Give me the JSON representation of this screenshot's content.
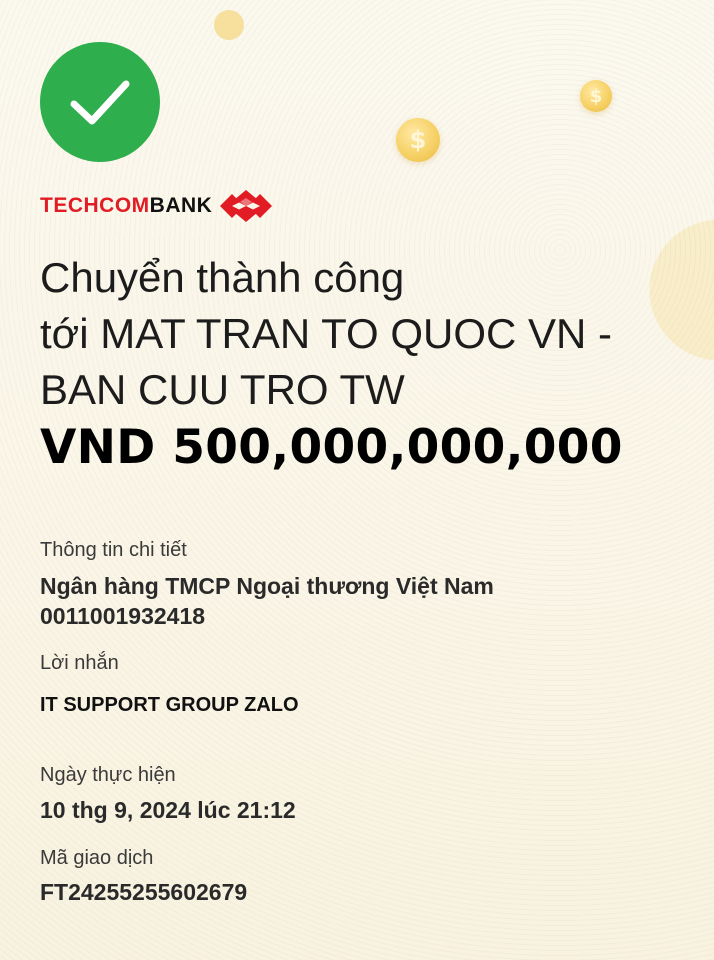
{
  "status": {
    "icon": "checkmark-icon",
    "color": "#2eae4d"
  },
  "bank": {
    "name_red": "TECHCOM",
    "name_black": "BANK",
    "brand_color": "#e21c24",
    "logo_icon": "techcombank-diamond-logo"
  },
  "headline": {
    "line1": "Chuyển thành công",
    "line2": "tới MAT TRAN TO QUOC VN -",
    "line3": "BAN CUU TRO TW"
  },
  "amount": "VND 500,000,000,000",
  "details": {
    "info_label": "Thông tin chi tiết",
    "recipient_bank": "Ngân hàng TMCP Ngoại thương Việt Nam",
    "account_number": "0011001932418",
    "message_label": "Lời nhắn",
    "message": "IT SUPPORT GROUP ZALO",
    "date_label": "Ngày thực hiện",
    "date": "10 thg 9, 2024 lúc 21:12",
    "txn_label": "Mã giao dịch",
    "txn_id": "FT24255255602679"
  },
  "decor": {
    "coin_symbol": "$"
  }
}
